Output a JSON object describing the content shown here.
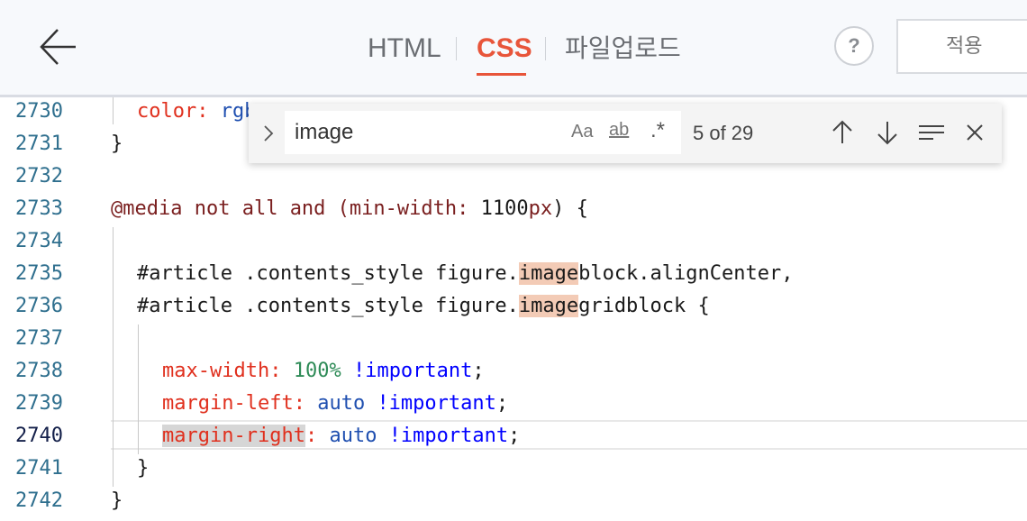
{
  "header": {
    "tabs": [
      {
        "label": "HTML",
        "active": false
      },
      {
        "label": "CSS",
        "active": true
      },
      {
        "label": "파일업로드",
        "active": false
      }
    ],
    "help_label": "?",
    "apply_label": "적용",
    "accent_color": "#e8553a"
  },
  "find": {
    "query": "image",
    "match_case_label": "Aa",
    "whole_word_label": "ab",
    "regex_label": ".*",
    "count": "5 of 29"
  },
  "editor": {
    "current_line": "2740",
    "lines": [
      {
        "num": "2730",
        "parts": {
          "prop": "color",
          "colon": ": ",
          "val": "rgb"
        }
      },
      {
        "num": "2731",
        "text": "}"
      },
      {
        "num": "2732",
        "text": ""
      },
      {
        "num": "2733",
        "parts": {
          "at": "@media",
          "mid": " not all and (",
          "feat": "min-width",
          "colon": ": ",
          "num": "1100",
          "unit": "px",
          "end": ") {"
        }
      },
      {
        "num": "2734",
        "text": ""
      },
      {
        "num": "2735",
        "parts": {
          "pre": "#article .contents_style figure.",
          "match": "image",
          "post": "block.alignCenter,"
        }
      },
      {
        "num": "2736",
        "parts": {
          "pre": "#article .contents_style figure.",
          "match": "image",
          "post": "gridblock {"
        }
      },
      {
        "num": "2737",
        "text": ""
      },
      {
        "num": "2738",
        "parts": {
          "prop": "max-width",
          "colon": ": ",
          "val": "100%",
          "sp": " ",
          "kw": "!important",
          "end": ";"
        }
      },
      {
        "num": "2739",
        "parts": {
          "prop": "margin-left",
          "colon": ": ",
          "val": "auto",
          "sp": " ",
          "kw": "!important",
          "end": ";"
        }
      },
      {
        "num": "2740",
        "parts": {
          "prop": "margin-right",
          "colon": ": ",
          "val": "auto",
          "sp": " ",
          "kw": "!important",
          "end": ";"
        }
      },
      {
        "num": "2741",
        "text": "}"
      },
      {
        "num": "2742",
        "text": "}"
      }
    ]
  }
}
